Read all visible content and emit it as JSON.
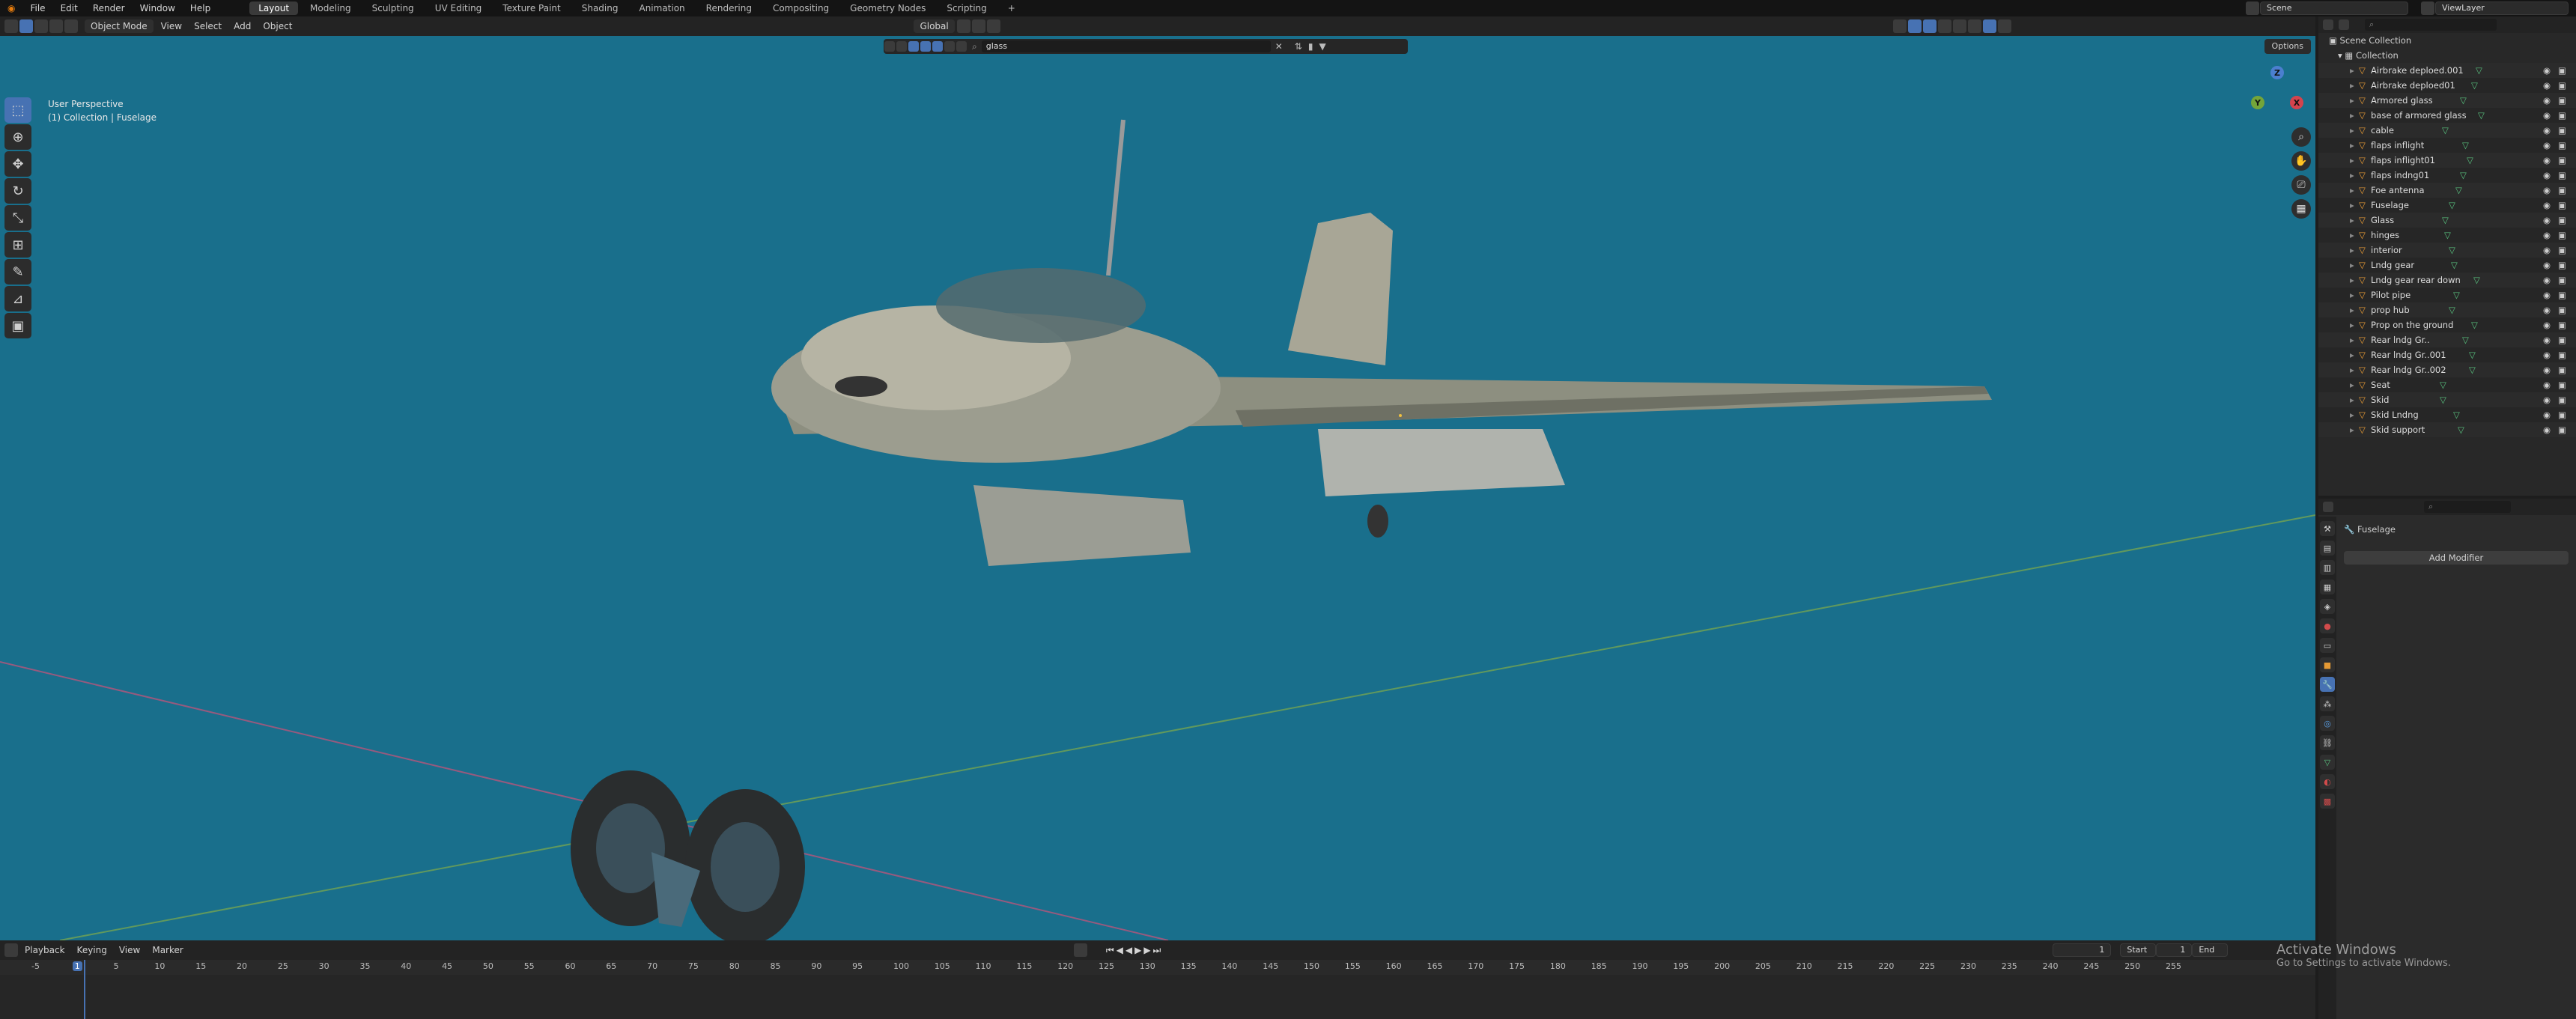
{
  "menu": [
    "File",
    "Edit",
    "Render",
    "Window",
    "Help"
  ],
  "workspaces": [
    "Layout",
    "Modeling",
    "Sculpting",
    "UV Editing",
    "Texture Paint",
    "Shading",
    "Animation",
    "Rendering",
    "Compositing",
    "Geometry Nodes",
    "Scripting",
    "+"
  ],
  "active_workspace": "Layout",
  "scene": {
    "name": "Scene",
    "view_layer": "ViewLayer"
  },
  "viewport_header": {
    "mode": "Object Mode",
    "menus": [
      "View",
      "Select",
      "Add",
      "Object"
    ],
    "orientation": "Global",
    "filter_value": "glass",
    "options": "Options"
  },
  "viewport_info": {
    "line1": "User Perspective",
    "line2": "(1) Collection | Fuselage"
  },
  "gizmo": {
    "x": "X",
    "y": "Y",
    "z": "Z"
  },
  "outliner": {
    "root": "Scene Collection",
    "collection": "Collection",
    "items": [
      "Airbrake deploed.001",
      "Airbrake deploed01",
      "Armored glass",
      "base of armored glass",
      "cable",
      "flaps inflight",
      "flaps inflight01",
      "flaps indng01",
      "Foe antenna",
      "Fuselage",
      "Glass",
      "hinges",
      "interior",
      "Lndg gear",
      "Lndg gear rear down",
      "Pilot pipe",
      "prop hub",
      "Prop on the ground",
      "Rear lndg Gr..",
      "Rear lndg Gr..001",
      "Rear lndg Gr..002",
      "Seat",
      "Skid",
      "Skid Lndng",
      "Skid support"
    ]
  },
  "properties": {
    "object": "Fuselage",
    "add_modifier": "Add Modifier"
  },
  "timeline": {
    "menus": [
      "Playback",
      "Keying",
      "View",
      "Marker"
    ],
    "current_frame": "1",
    "start_label": "Start",
    "start": "1",
    "end_label": "End",
    "ticks": [
      "-5",
      "1",
      "5",
      "10",
      "15",
      "20",
      "25",
      "30",
      "35",
      "40",
      "45",
      "50",
      "55",
      "60",
      "65",
      "70",
      "75",
      "80",
      "85",
      "90",
      "95",
      "100",
      "105",
      "110",
      "115",
      "120",
      "125",
      "130",
      "135",
      "140",
      "145",
      "150",
      "155",
      "160",
      "165",
      "170",
      "175",
      "180",
      "185",
      "190",
      "195",
      "200",
      "205",
      "210",
      "215",
      "220",
      "225",
      "230",
      "235",
      "240",
      "245",
      "250",
      "255"
    ]
  },
  "activate_windows": {
    "title": "Activate Windows",
    "subtitle": "Go to Settings to activate Windows."
  },
  "colors": {
    "viewport_bg": "#196f8c",
    "accent": "#4772b3"
  }
}
